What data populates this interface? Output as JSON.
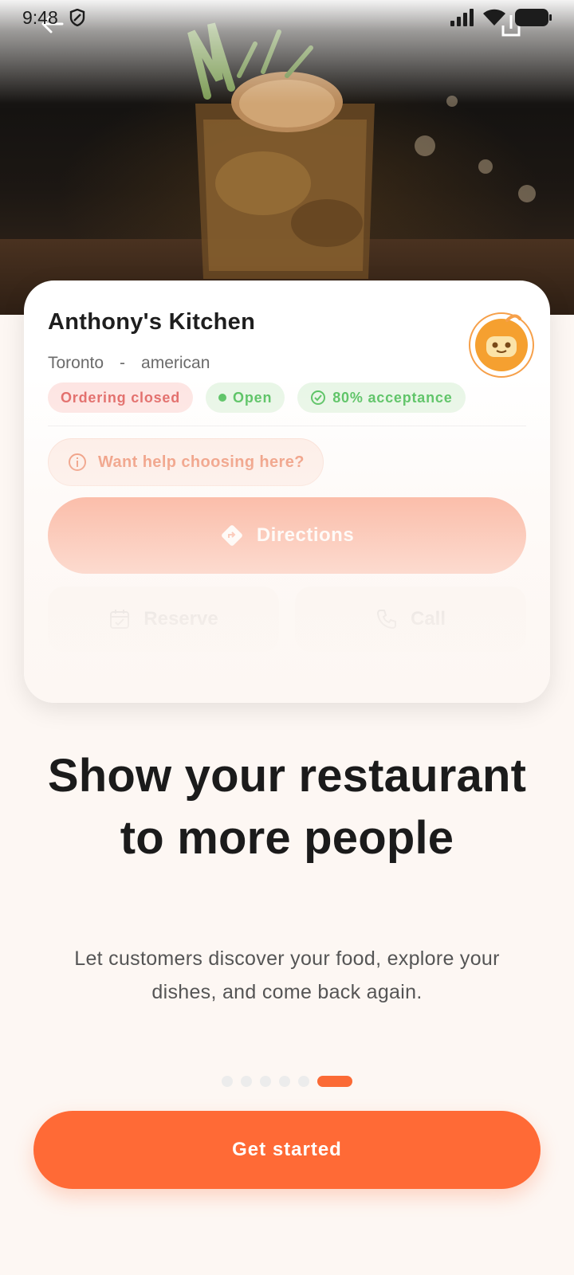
{
  "status_bar": {
    "time": "9:48"
  },
  "restaurant": {
    "name": "Anthony's Kitchen",
    "city": "Toronto",
    "separator": "-",
    "cuisine": "american",
    "chips": {
      "ordering": "Ordering closed",
      "open": "Open",
      "acceptance": "80% acceptance"
    },
    "help_prompt": "Want help choosing here?",
    "actions": {
      "directions": "Directions",
      "reserve": "Reserve",
      "call": "Call"
    }
  },
  "onboarding": {
    "headline": "Show your restaurant to more people",
    "subtitle": "Let customers discover your food, explore your dishes, and come back again.",
    "pager": {
      "total": 6,
      "active_index": 5
    },
    "cta_label": "Get started"
  },
  "colors": {
    "accent": "#ff6a36",
    "closed_chip_text": "#e0625f",
    "open_chip_text": "#4fbf5a",
    "background": "#fdf7f3"
  },
  "icons": {
    "back": "arrow-left-icon",
    "share": "share-icon",
    "shield": "shield-icon",
    "signal": "signal-icon",
    "wifi": "wifi-icon",
    "battery": "battery-icon",
    "mascot": "robot-mascot-icon",
    "info": "info-icon",
    "check_badge": "check-badge-icon",
    "directions": "directions-icon",
    "calendar": "calendar-icon",
    "phone": "phone-icon"
  }
}
